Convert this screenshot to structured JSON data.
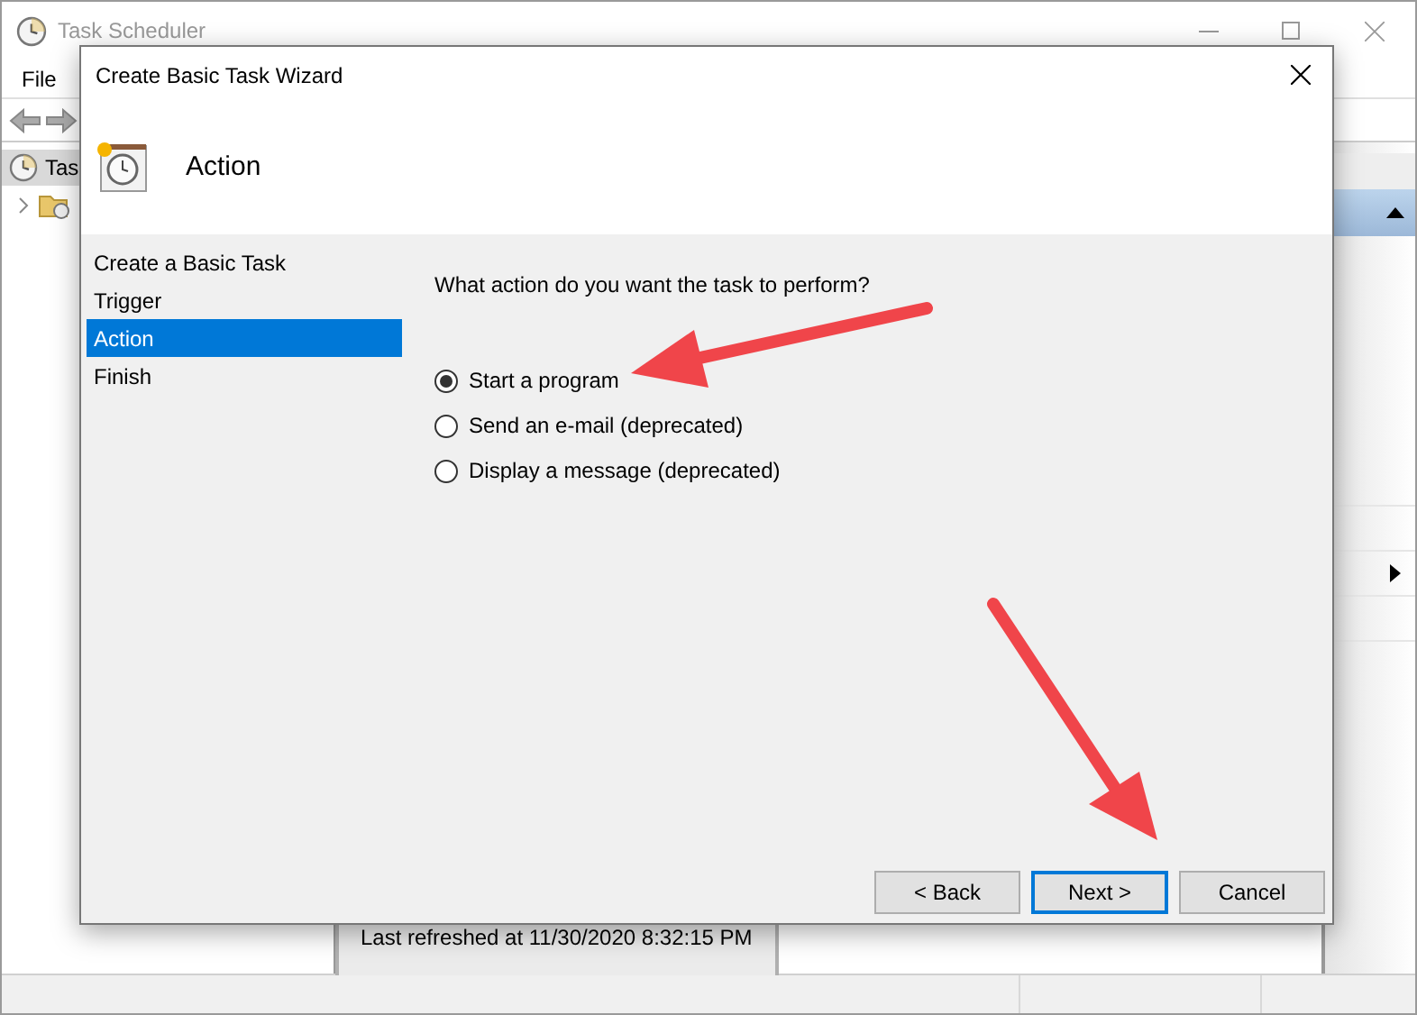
{
  "window": {
    "title": "Task Scheduler"
  },
  "menu": [
    "File"
  ],
  "tree": [
    {
      "label": "Tas",
      "selected": true
    }
  ],
  "refresh_note": "Last refreshed at 11/30/2020 8:32:15 PM",
  "dialog": {
    "title": "Create Basic Task Wizard",
    "heading": "Action",
    "steps": [
      {
        "label": "Create a Basic Task",
        "selected": false
      },
      {
        "label": "Trigger",
        "selected": false
      },
      {
        "label": "Action",
        "selected": true
      },
      {
        "label": "Finish",
        "selected": false
      }
    ],
    "question": "What action do you want the task to perform?",
    "options": [
      {
        "label": "Start a program",
        "selected": true
      },
      {
        "label": "Send an e-mail (deprecated)",
        "selected": false
      },
      {
        "label": "Display a message (deprecated)",
        "selected": false
      }
    ],
    "buttons": [
      {
        "label": "< Back",
        "default": false
      },
      {
        "label": "Next >",
        "default": true
      },
      {
        "label": "Cancel",
        "default": false
      }
    ]
  }
}
